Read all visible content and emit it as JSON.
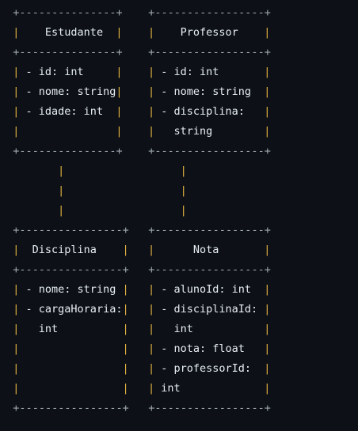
{
  "diagram": {
    "lines": [
      "  +---------------+    +-----------------+",
      "  |    Estudante  |    |    Professor    |",
      "  +---------------+    +-----------------+",
      "  | - id: int     |    | - id: int       |",
      "  | - nome: string|    | - nome: string  |",
      "  | - idade: int  |    | - disciplina:   |",
      "  |               |    |   string        |",
      "  +---------------+    +-----------------+",
      "         |                  |",
      "         |                  |",
      "         |                  |",
      "  +----------------+   +-----------------+",
      "  |  Disciplina    |   |      Nota       |",
      "  +----------------+   +-----------------+",
      "  | - nome: string |   | - alunoId: int  |",
      "  | - cargaHoraria:|   | - disciplinaId: |",
      "  |   int          |   |   int           |",
      "  |                |   | - nota: float   |",
      "  |                |   | - professorId:  |",
      "  |                |   | int             |",
      "  +----------------+   +-----------------+"
    ]
  }
}
